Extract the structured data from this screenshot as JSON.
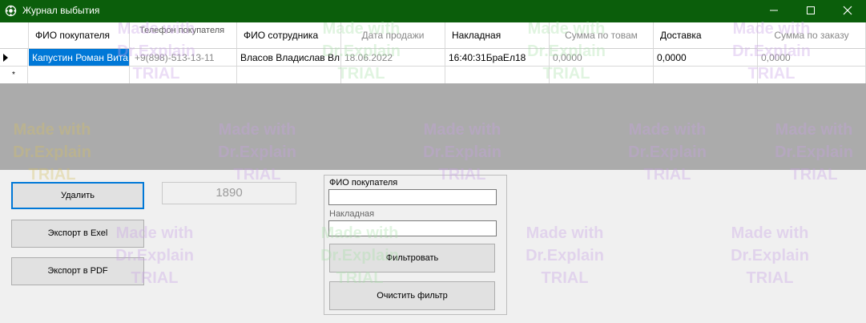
{
  "window": {
    "title": "Журнал выбытия",
    "minimize_icon": "minimize-icon",
    "maximize_icon": "maximize-icon",
    "close_icon": "close-icon"
  },
  "grid": {
    "columns": [
      "ФИО покупателя",
      "Телефон покупателя",
      "ФИО сотрудника",
      "Дата продажи",
      "Накладная",
      "Сумма по товам",
      "Доставка",
      "Сумма по заказу"
    ],
    "rows": [
      [
        "Капустин Роман Вита",
        "+9(898)-513-13-11",
        "Власов Владислав Вл...",
        "18.06.2022",
        "16:40:31БраЕл18",
        "0,0000",
        "0,0000",
        "0,0000"
      ]
    ],
    "new_row_marker": "*"
  },
  "actions": {
    "delete": "Удалить",
    "export_excel": "Экспорт в Exel",
    "export_pdf": "Экспорт в PDF"
  },
  "counter": "1890",
  "filter": {
    "buyer_label": "ФИО покупателя",
    "buyer_value": "",
    "invoice_label": "Накладная",
    "invoice_value": "",
    "apply": "Фильтровать",
    "clear": "Очистить фильтр"
  },
  "watermark": {
    "line1": "Made with",
    "line2": "Dr.Explain",
    "line3": "TRIAL"
  },
  "colors": {
    "titlebar": "#0b5e0b",
    "selection": "#0078d7",
    "overlay": "#ababab",
    "background": "#f0f0f0"
  }
}
